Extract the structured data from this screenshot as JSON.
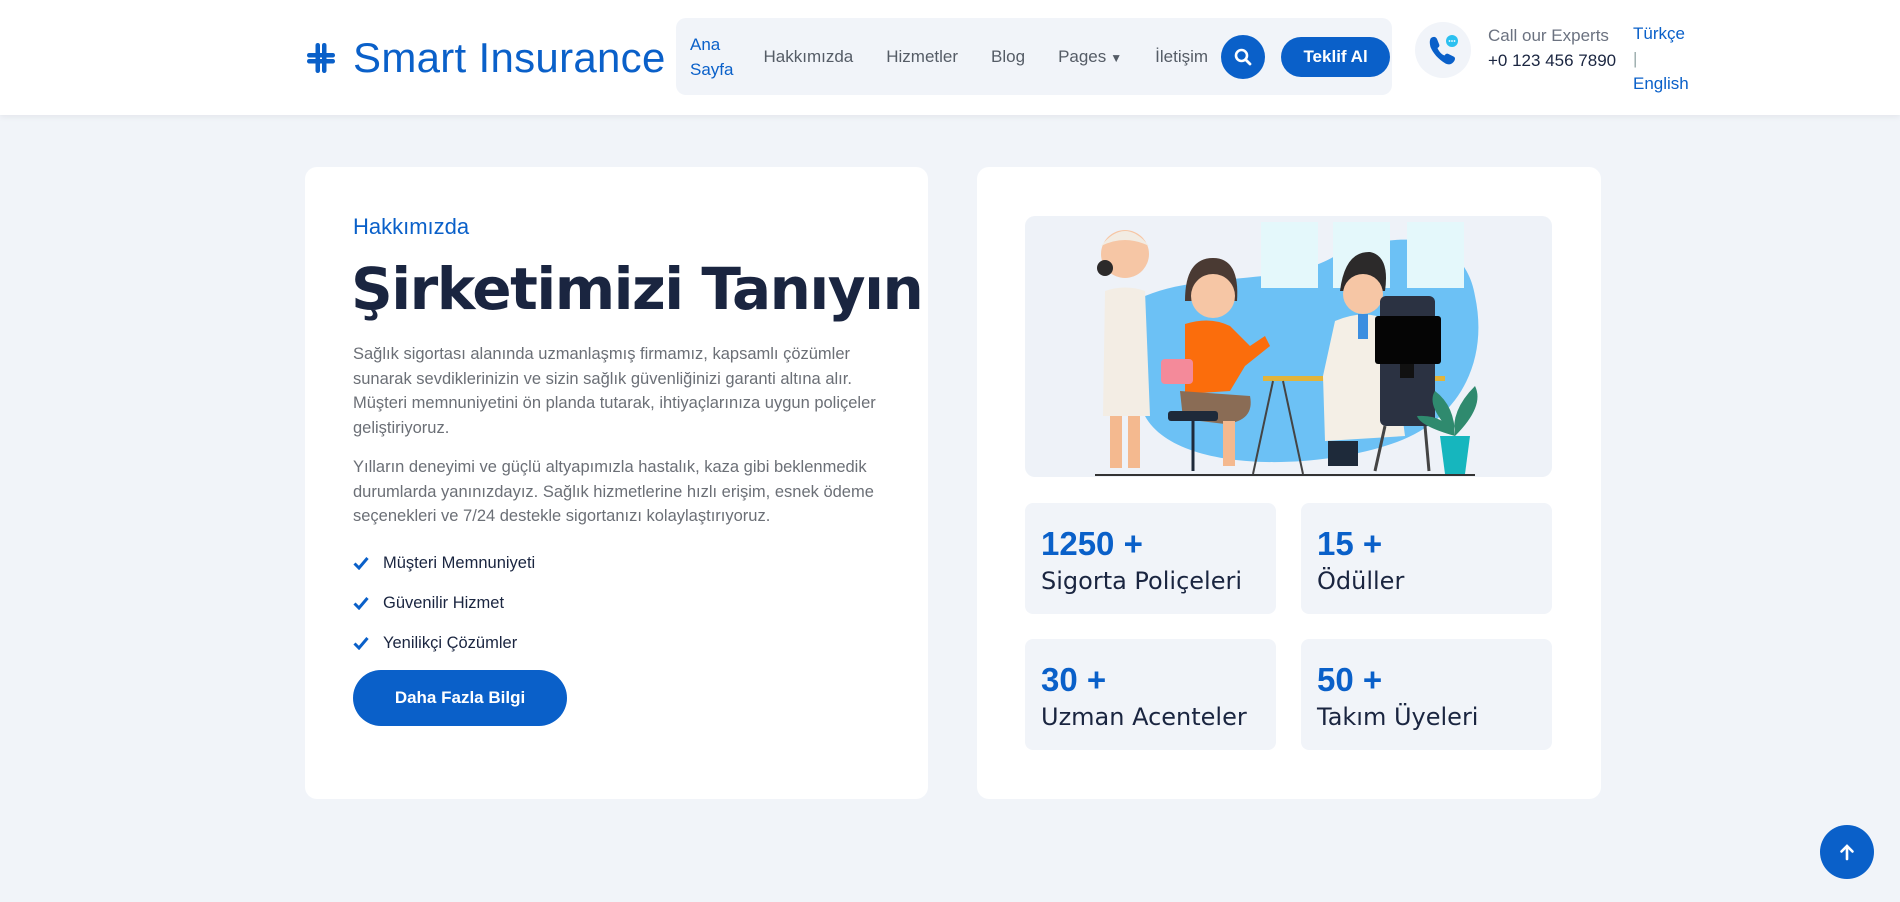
{
  "header": {
    "brand": "Smart Insurance",
    "nav": [
      {
        "label": "Ana"
      },
      {
        "label": "Sayfa"
      },
      {
        "label": "Hakkımızda"
      },
      {
        "label": "Hizmetler"
      },
      {
        "label": "Blog"
      },
      {
        "label": "Pages"
      },
      {
        "label": "İletişim"
      }
    ],
    "quote_button": "Teklif Al",
    "call_label": "Call our Experts",
    "phone": "+0 123 456 7890",
    "lang_tr": "Türkçe",
    "lang_sep": "|",
    "lang_en": "English"
  },
  "about": {
    "kicker": "Hakkımızda",
    "title": "Şirketimizi Tanıyın",
    "paragraph1": "Sağlık sigortası alanında uzmanlaşmış firmamız, kapsamlı çözümler sunarak sevdiklerinizin ve sizin sağlık güvenliğinizi garanti altına alır. Müşteri memnuniyetini ön planda tutarak, ihtiyaçlarınıza uygun poliçeler geliştiriyoruz.",
    "paragraph2": "Yılların deneyimi ve güçlü altyapımızla hastalık, kaza gibi beklenmedik durumlarda yanınızdayız. Sağlık hizmetlerine hızlı erişim, esnek ödeme seçenekleri ve 7/24 destekle sigortanızı kolaylaştırıyoruz.",
    "checklist": [
      "Müşteri Memnuniyeti",
      "Güvenilir Hizmet",
      "Yenilikçi Çözümler"
    ],
    "cta": "Daha Fazla Bilgi"
  },
  "stats": [
    {
      "number": "1250 +",
      "label": "Sigorta Poliçeleri"
    },
    {
      "number": "15 +",
      "label": "Ödüller"
    },
    {
      "number": "30 +",
      "label": "Uzman Acenteler"
    },
    {
      "number": "50 +",
      "label": "Takım Üyeleri"
    }
  ],
  "colors": {
    "accent": "#0a60c9",
    "background": "#f1f4f9",
    "heading": "#1a2540"
  }
}
